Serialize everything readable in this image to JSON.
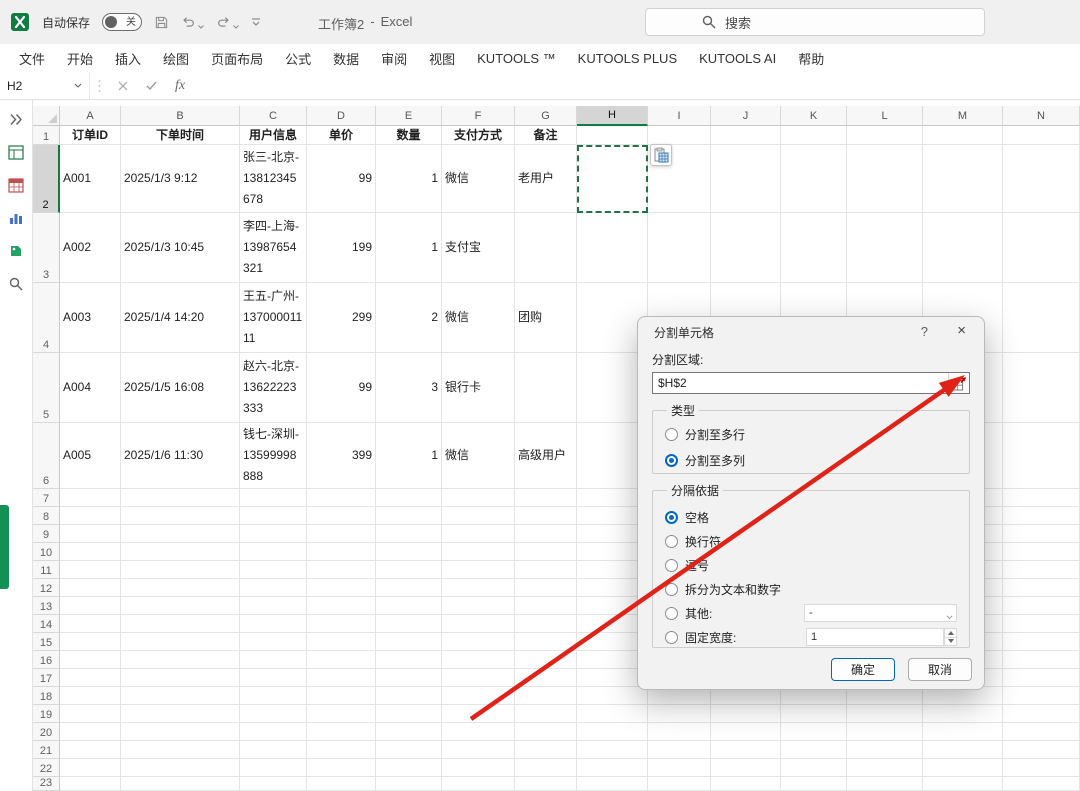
{
  "title_bar": {
    "autosave_label": "自动保存",
    "autosave_state": "关",
    "workbook_title": "工作簿2",
    "title_separator": "-",
    "app_name": "Excel",
    "search_placeholder": "搜索"
  },
  "ribbon": {
    "tabs": [
      {
        "label": "文件"
      },
      {
        "label": "开始"
      },
      {
        "label": "插入"
      },
      {
        "label": "绘图"
      },
      {
        "label": "页面布局"
      },
      {
        "label": "公式"
      },
      {
        "label": "数据"
      },
      {
        "label": "审阅"
      },
      {
        "label": "视图"
      },
      {
        "label": "KUTOOLS ™"
      },
      {
        "label": "KUTOOLS PLUS"
      },
      {
        "label": "KUTOOLS AI"
      },
      {
        "label": "帮助"
      }
    ]
  },
  "formula_bar": {
    "name_box_value": "H2",
    "fx_label": "fx",
    "formula_value": ""
  },
  "grid": {
    "column_letters": [
      "A",
      "B",
      "C",
      "D",
      "E",
      "F",
      "G",
      "H",
      "I",
      "J",
      "K",
      "L",
      "M",
      "N"
    ],
    "row_count": 23,
    "selected_cell": "H2",
    "selected_column": "H",
    "selected_row": 2
  },
  "sheet": {
    "header_row": [
      "订单ID",
      "下单时间",
      "用户信息",
      "单价",
      "数量",
      "支付方式",
      "备注"
    ],
    "records": [
      [
        "A001",
        "2025/1/3 9:12",
        "张三-北京-13812345678",
        "99",
        "1",
        "微信",
        "老用户"
      ],
      [
        "A002",
        "2025/1/3 10:45",
        "李四-上海-13987654321",
        "199",
        "1",
        "支付宝",
        ""
      ],
      [
        "A003",
        "2025/1/4 14:20",
        "王五-广州-13700001111",
        "299",
        "2",
        "微信",
        "团购"
      ],
      [
        "A004",
        "2025/1/5 16:08",
        "赵六-北京-13622223333",
        "99",
        "3",
        "银行卡",
        ""
      ],
      [
        "A005",
        "2025/1/6 11:30",
        "钱七-深圳-13599998888",
        "399",
        "1",
        "微信",
        "高级用户"
      ]
    ]
  },
  "side_pane": {
    "icons": [
      "double-chevron-icon",
      "worksheet-icon",
      "table-icon",
      "chart-icon",
      "bookmark-icon",
      "search-icon"
    ]
  },
  "dialog": {
    "title": "分割单元格",
    "help_glyph": "?",
    "close_glyph": "×",
    "range_section_label": "分割区域:",
    "range_value": "$H$2",
    "type_group_label": "类型",
    "type_options": [
      {
        "label": "分割至多行",
        "selected": false
      },
      {
        "label": "分割至多列",
        "selected": true
      }
    ],
    "separator_group_label": "分隔依据",
    "separator_options": [
      {
        "label": "空格",
        "selected": true
      },
      {
        "label": "换行符",
        "selected": false
      },
      {
        "label": "逗号",
        "selected": false
      },
      {
        "label": "拆分为文本和数字",
        "selected": false
      },
      {
        "label": "其他:",
        "selected": false,
        "input_value": "-"
      },
      {
        "label": "固定宽度:",
        "selected": false,
        "input_value": "1",
        "has_spinner": true
      }
    ],
    "ok_label": "确定",
    "cancel_label": "取消"
  }
}
